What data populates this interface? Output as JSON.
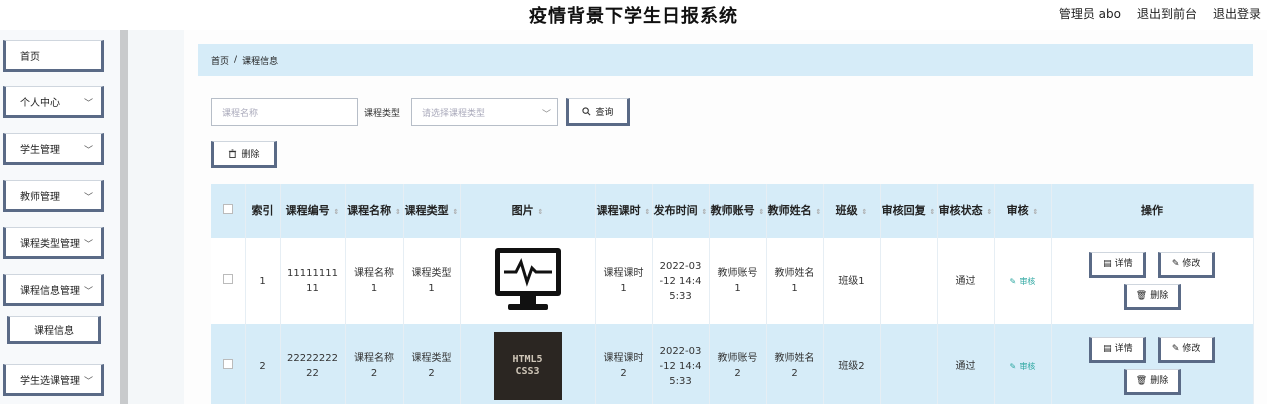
{
  "header": {
    "title": "疫情背景下学生日报系统",
    "user": "管理员 abo",
    "front_link": "退出到前台",
    "logout": "退出登录"
  },
  "sidebar": {
    "items": [
      {
        "label": "首页",
        "has_chevron": false
      },
      {
        "label": "个人中心",
        "has_chevron": true
      },
      {
        "label": "学生管理",
        "has_chevron": true
      },
      {
        "label": "教师管理",
        "has_chevron": true
      },
      {
        "label": "课程类型管理",
        "has_chevron": true
      },
      {
        "label": "课程信息管理",
        "has_chevron": true
      },
      {
        "label": "学生选课管理",
        "has_chevron": true
      }
    ],
    "sub_item": "课程信息"
  },
  "breadcrumb": {
    "home": "首页",
    "sep": "/",
    "current": "课程信息"
  },
  "search": {
    "name_placeholder": "课程名称",
    "type_label": "课程类型",
    "type_placeholder": "请选择课程类型",
    "query_button": "查询",
    "delete_button": "删除"
  },
  "table": {
    "headers": [
      "",
      "索引",
      "课程编号",
      "课程名称",
      "课程类型",
      "图片",
      "课程课时",
      "发布时间",
      "教师账号",
      "教师姓名",
      "班级",
      "审核回复",
      "审核状态",
      "审核",
      "操作"
    ],
    "rows": [
      {
        "index": "1",
        "code": "1111111111",
        "name": "课程名称1",
        "type": "课程类型1",
        "image": "monitor-icon",
        "hours": "课程课时1",
        "time": "2022-03-12 14:45:33",
        "teacher_account": "教师账号1",
        "teacher_name": "教师姓名1",
        "class": "班级1",
        "reply": "",
        "status": "通过",
        "audit": "审核"
      },
      {
        "index": "2",
        "code": "2222222222",
        "name": "课程名称2",
        "type": "课程类型2",
        "image": "html5-css3-image",
        "image_text_1": "HTML5",
        "image_text_2": "CSS3",
        "hours": "课程课时2",
        "time": "2022-03-12 14:45:33",
        "teacher_account": "教师账号2",
        "teacher_name": "教师姓名2",
        "class": "班级2",
        "reply": "",
        "status": "通过",
        "audit": "审核"
      }
    ],
    "actions": {
      "detail": "详情",
      "edit": "修改",
      "delete": "删除"
    }
  },
  "colors": {
    "accent_blue": "#d6ecf8",
    "button_border": "#5a6a86",
    "audit_link": "#2ba6a0"
  }
}
